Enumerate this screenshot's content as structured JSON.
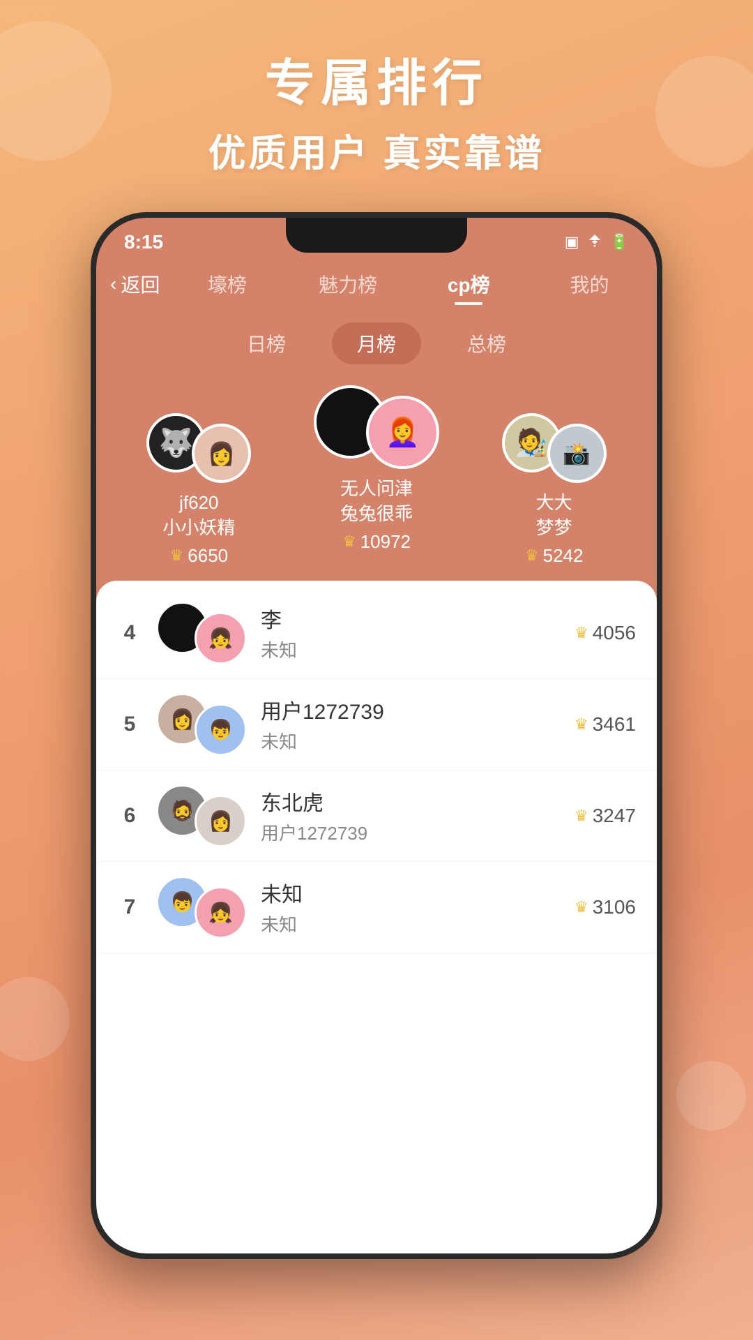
{
  "background": {
    "title_main": "专属排行",
    "title_sub": "优质用户 真实靠谱"
  },
  "status_bar": {
    "time": "8:15",
    "icons": [
      "📳",
      "WiFi",
      "🔋"
    ]
  },
  "nav": {
    "back_label": "返回",
    "tabs": [
      {
        "label": "壕榜",
        "active": false
      },
      {
        "label": "魅力榜",
        "active": false
      },
      {
        "label": "cp榜",
        "active": true
      },
      {
        "label": "我的",
        "active": false
      }
    ]
  },
  "period_tabs": [
    {
      "label": "日榜",
      "active": false
    },
    {
      "label": "月榜",
      "active": true
    },
    {
      "label": "总榜",
      "active": false
    }
  ],
  "top3": [
    {
      "rank": 2,
      "name1": "jf620",
      "name2": "小小妖精",
      "score": 6650,
      "avatar_left_type": "wolf",
      "avatar_right_type": "girl_selfie"
    },
    {
      "rank": 1,
      "name1": "无人问津",
      "name2": "兔兔很乖",
      "score": 10972,
      "avatar_left_type": "dark",
      "avatar_right_type": "girl_pink"
    },
    {
      "rank": 3,
      "name1": "大大",
      "name2": "梦梦",
      "score": 5242,
      "avatar_left_type": "anime_girl",
      "avatar_right_type": "girl_selfie2"
    }
  ],
  "list": [
    {
      "rank": 4,
      "name1": "李",
      "name2": "未知",
      "score": 4056,
      "avatar_left_color": "dark",
      "avatar_right_color": "pink"
    },
    {
      "rank": 5,
      "name1": "用户1272739",
      "name2": "未知",
      "score": 3461,
      "avatar_left_color": "tan",
      "avatar_right_color": "blue"
    },
    {
      "rank": 6,
      "name1": "东北虎",
      "name2": "用户1272739",
      "score": 3247,
      "avatar_left_color": "dark2",
      "avatar_right_color": "light"
    },
    {
      "rank": 7,
      "name1": "未知",
      "name2": "未知",
      "score": 3106,
      "avatar_left_color": "blue",
      "avatar_right_color": "pink"
    }
  ]
}
